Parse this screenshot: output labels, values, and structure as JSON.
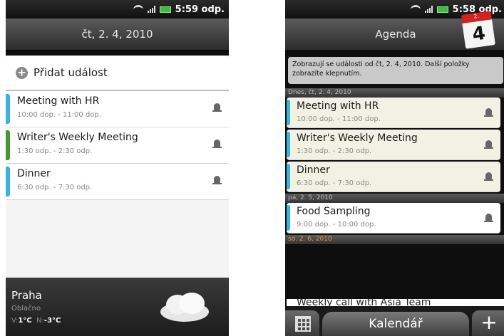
{
  "left_screen": {
    "status_time": "5:59 odp.",
    "date": "čt, 2. 4, 2010",
    "add_event_label": "Přidat událost",
    "events": [
      {
        "title": "Meeting with HR",
        "time": "10:00 dop. - 11:00 dop.",
        "color": "#39b3e0"
      },
      {
        "title": "Writer's Weekly Meeting",
        "time": "1:30 odp. - 2:30 odp.",
        "color": "#3f9b2f"
      },
      {
        "title": "Dinner",
        "time": "6:30 odp. - 7:30 odp.",
        "color": "#39b3e0"
      }
    ],
    "weather": {
      "city": "Praha",
      "condition": "Oblačno",
      "high_label": "V:",
      "high": "1°C",
      "low_label": "N:",
      "low": "-3°C"
    }
  },
  "right_screen": {
    "status_time": "5:58 odp.",
    "title": "Agenda",
    "calendar_month": "2.",
    "calendar_day": "4",
    "notice": "Zobrazují se události od čt, 2. 4, 2010. Další položky zobrazíte klepnutím.",
    "sections": [
      {
        "label": "Dnes, čt, 2. 4, 2010",
        "events": [
          {
            "title": "Meeting with HR",
            "time": "10:00 dop. - 11:00 dop.",
            "color": "#39b3e0"
          },
          {
            "title": "Writer's Weekly Meeting",
            "time": "1:30 odp. - 2:30 odp.",
            "color": "#39b3e0"
          },
          {
            "title": "Dinner",
            "time": "6:30 odp. - 7:30 odp.",
            "color": "#39b3e0"
          }
        ]
      },
      {
        "label": "pá, 2. 5, 2010",
        "events": [
          {
            "title": "Food Sampling",
            "time": "9:00 dop. - 10:00 dop.",
            "color": "#39b3e0"
          }
        ]
      },
      {
        "label": "so, 2. 6, 2010",
        "events": []
      }
    ],
    "peek_event": "Weekly call with Asia Team",
    "bottom_label": "Kalendář",
    "add_symbol": "+"
  }
}
